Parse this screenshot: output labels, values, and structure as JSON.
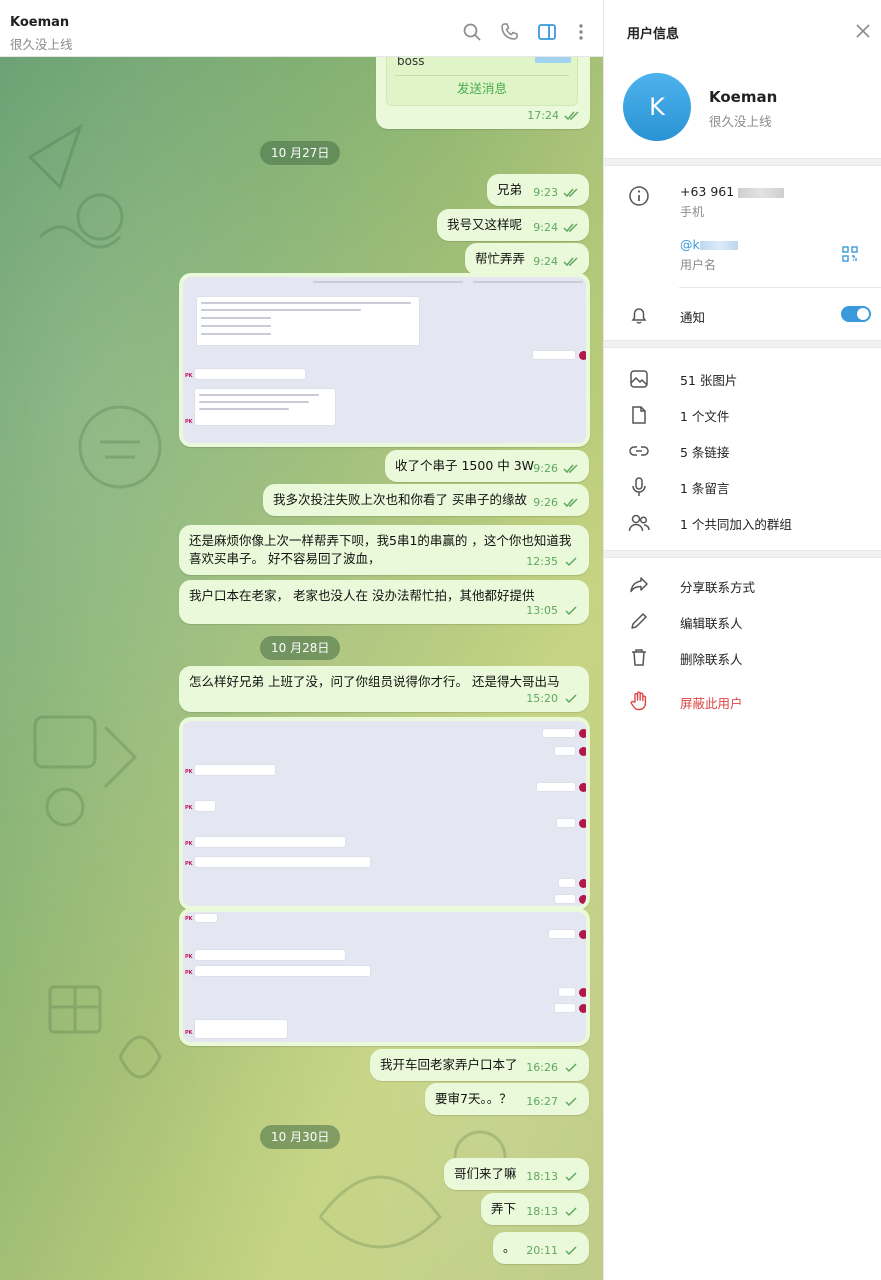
{
  "chat": {
    "header": {
      "name": "Koeman",
      "status": "很久没上线"
    },
    "top_bubble": {
      "partial_text": "boss",
      "button_label": "发送消息",
      "time": "17:24"
    },
    "dates": [
      "10 月27日",
      "10 月28日",
      "10 月30日"
    ],
    "messages": [
      {
        "text": "兄弟",
        "time": "9:23"
      },
      {
        "text": "我号又这样呢",
        "time": "9:24"
      },
      {
        "text": "帮忙弄弄",
        "time": "9:24"
      },
      {
        "text": "收了个串子 1500 中 3W",
        "time": "9:26"
      },
      {
        "text": "我多次投注失败上次也和你看了 买串子的缘故",
        "time": "9:26"
      },
      {
        "text": "还是麻烦你像上次一样帮弄下呗，我5串1的串赢的 ，这个你也知道我喜欢买串子。 好不容易回了波血，",
        "time": "12:35"
      },
      {
        "text": "我户口本在老家， 老家也没人在 没办法帮忙拍，其他都好提供",
        "time": "13:05"
      },
      {
        "text": "怎么样好兄弟 上班了没，问了你组员说得你才行。 还是得大哥出马",
        "time": "15:20"
      },
      {
        "text": "我开车回老家弄户口本了",
        "time": "16:26"
      },
      {
        "text": "要审7天。。？",
        "time": "16:27"
      },
      {
        "text": "哥们来了嘛",
        "time": "18:13"
      },
      {
        "text": "弄下",
        "time": "18:13"
      },
      {
        "text": "。",
        "time": "20:11"
      }
    ]
  },
  "info": {
    "title": "用户信息",
    "profile": {
      "initial": "K",
      "name": "Koeman",
      "status": "很久没上线"
    },
    "phone": {
      "value": "+63 961",
      "label": "手机"
    },
    "username": {
      "value": "@k",
      "label": "用户名"
    },
    "notify_label": "通知",
    "notify_on": true,
    "media": [
      {
        "icon": "image-icon",
        "label": "51 张图片"
      },
      {
        "icon": "file-icon",
        "label": "1 个文件"
      },
      {
        "icon": "link-icon",
        "label": "5 条链接"
      },
      {
        "icon": "mic-icon",
        "label": "1 条留言"
      },
      {
        "icon": "group-icon",
        "label": "1 个共同加入的群组"
      }
    ],
    "actions": [
      {
        "icon": "share-icon",
        "label": "分享联系方式"
      },
      {
        "icon": "edit-icon",
        "label": "编辑联系人"
      },
      {
        "icon": "trash-icon",
        "label": "删除联系人"
      },
      {
        "icon": "block-hand-icon",
        "label": "屏蔽此用户"
      }
    ]
  },
  "colors": {
    "bubble": "#e9f9d9",
    "check": "#5fa861",
    "accent": "#3a99db",
    "danger": "#e04545"
  }
}
